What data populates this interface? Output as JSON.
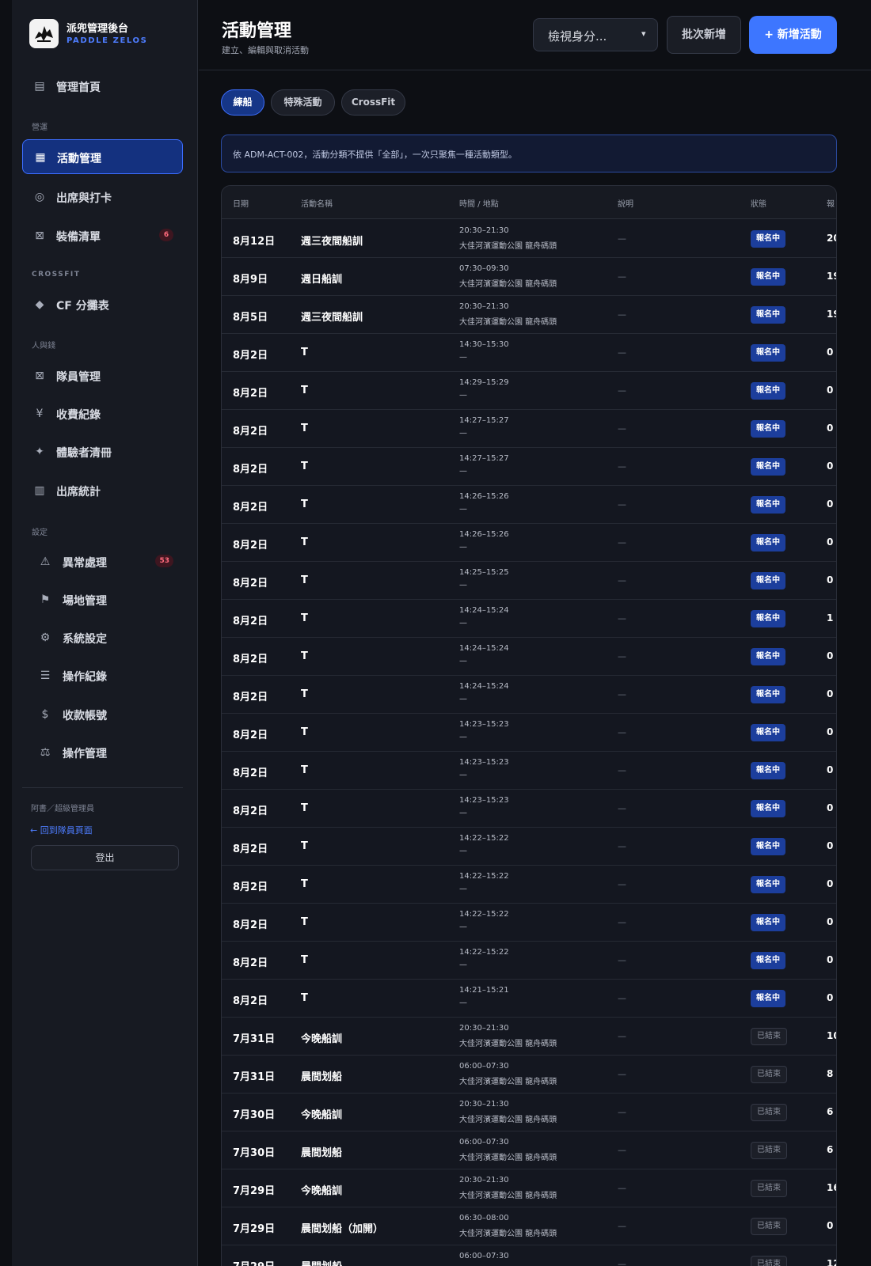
{
  "brand": {
    "title": "派兜管理後台",
    "subtitle": "PADDLE ZELOS"
  },
  "sidebar": {
    "items": [
      {
        "id": "home",
        "label": "管理首頁",
        "icon": "list-icon",
        "glyph": "▤"
      },
      {
        "id": "activities",
        "label": "活動管理",
        "icon": "grid-icon",
        "glyph": "▦"
      },
      {
        "id": "attendance",
        "label": "出席與打卡",
        "icon": "target-icon",
        "glyph": "◎"
      },
      {
        "id": "equipment",
        "label": "裝備清單",
        "icon": "box-icon",
        "glyph": "⊠",
        "badge": "6"
      },
      {
        "id": "cf-groups",
        "label": "CF 分攤表",
        "icon": "diamond-icon",
        "glyph": "◆"
      },
      {
        "id": "members",
        "label": "隊員管理",
        "icon": "user-card-icon",
        "glyph": "⊠"
      },
      {
        "id": "payments",
        "label": "收費紀錄",
        "icon": "yen-icon",
        "glyph": "¥"
      },
      {
        "id": "trials",
        "label": "體驗者清冊",
        "icon": "sparkle-icon",
        "glyph": "✦"
      },
      {
        "id": "stats",
        "label": "出席統計",
        "icon": "columns-icon",
        "glyph": "▥"
      },
      {
        "id": "exceptions",
        "label": "異常處理",
        "icon": "warning-icon",
        "glyph": "⚠",
        "badge": "53"
      },
      {
        "id": "venues",
        "label": "場地管理",
        "icon": "flag-icon",
        "glyph": "⚑"
      },
      {
        "id": "settings",
        "label": "系統設定",
        "icon": "gear-icon",
        "glyph": "⚙"
      },
      {
        "id": "logs",
        "label": "操作紀錄",
        "icon": "menu-icon",
        "glyph": "☰"
      },
      {
        "id": "accounts",
        "label": "收款帳號",
        "icon": "dollar-icon",
        "glyph": "$"
      },
      {
        "id": "operations",
        "label": "操作管理",
        "icon": "scale-icon",
        "glyph": "⚖"
      }
    ],
    "sections": {
      "ops": "營運",
      "crossfit": "CROSSFIT",
      "people": "人與錢",
      "settings": "設定"
    },
    "user": "阿書／超級管理員",
    "back_link": "← 回到隊員頁面",
    "logout": "登出"
  },
  "header": {
    "title": "活動管理",
    "subtitle": "建立、編輯與取消活動",
    "role_select": "檢視身分...",
    "batch_button": "批次新增",
    "new_button": "+ 新增活動"
  },
  "tabs": [
    "練船",
    "特殊活動",
    "CrossFit"
  ],
  "notice": "依 ADM-ACT-002，活動分類不提供「全部」，一次只聚焦一種活動類型。",
  "table": {
    "headers": [
      "日期",
      "活動名稱",
      "時間 / 地點",
      "說明",
      "狀態",
      "報"
    ],
    "rows": [
      {
        "date": "8月12日",
        "name": "週三夜間船訓",
        "time": "20:30–21:30",
        "place": "大佳河濱運動公園 龍舟碼頭",
        "desc": "—",
        "status": "報名中",
        "signup": "20"
      },
      {
        "date": "8月9日",
        "name": "週日船訓",
        "time": "07:30–09:30",
        "place": "大佳河濱運動公園 龍舟碼頭",
        "desc": "—",
        "status": "報名中",
        "signup": "19"
      },
      {
        "date": "8月5日",
        "name": "週三夜間船訓",
        "time": "20:30–21:30",
        "place": "大佳河濱運動公園 龍舟碼頭",
        "desc": "—",
        "status": "報名中",
        "signup": "19"
      },
      {
        "date": "8月2日",
        "name": "T",
        "time": "14:30–15:30",
        "place": "—",
        "desc": "—",
        "status": "報名中",
        "signup": "0 /"
      },
      {
        "date": "8月2日",
        "name": "T",
        "time": "14:29–15:29",
        "place": "—",
        "desc": "—",
        "status": "報名中",
        "signup": "0 /"
      },
      {
        "date": "8月2日",
        "name": "T",
        "time": "14:27–15:27",
        "place": "—",
        "desc": "—",
        "status": "報名中",
        "signup": "0 /"
      },
      {
        "date": "8月2日",
        "name": "T",
        "time": "14:27–15:27",
        "place": "—",
        "desc": "—",
        "status": "報名中",
        "signup": "0 /"
      },
      {
        "date": "8月2日",
        "name": "T",
        "time": "14:26–15:26",
        "place": "—",
        "desc": "—",
        "status": "報名中",
        "signup": "0 /"
      },
      {
        "date": "8月2日",
        "name": "T",
        "time": "14:26–15:26",
        "place": "—",
        "desc": "—",
        "status": "報名中",
        "signup": "0 /"
      },
      {
        "date": "8月2日",
        "name": "T",
        "time": "14:25–15:25",
        "place": "—",
        "desc": "—",
        "status": "報名中",
        "signup": "0 /"
      },
      {
        "date": "8月2日",
        "name": "T",
        "time": "14:24–15:24",
        "place": "—",
        "desc": "—",
        "status": "報名中",
        "signup": "1 /"
      },
      {
        "date": "8月2日",
        "name": "T",
        "time": "14:24–15:24",
        "place": "—",
        "desc": "—",
        "status": "報名中",
        "signup": "0 /"
      },
      {
        "date": "8月2日",
        "name": "T",
        "time": "14:24–15:24",
        "place": "—",
        "desc": "—",
        "status": "報名中",
        "signup": "0 /"
      },
      {
        "date": "8月2日",
        "name": "T",
        "time": "14:23–15:23",
        "place": "—",
        "desc": "—",
        "status": "報名中",
        "signup": "0 /"
      },
      {
        "date": "8月2日",
        "name": "T",
        "time": "14:23–15:23",
        "place": "—",
        "desc": "—",
        "status": "報名中",
        "signup": "0 /"
      },
      {
        "date": "8月2日",
        "name": "T",
        "time": "14:23–15:23",
        "place": "—",
        "desc": "—",
        "status": "報名中",
        "signup": "0 /"
      },
      {
        "date": "8月2日",
        "name": "T",
        "time": "14:22–15:22",
        "place": "—",
        "desc": "—",
        "status": "報名中",
        "signup": "0 /"
      },
      {
        "date": "8月2日",
        "name": "T",
        "time": "14:22–15:22",
        "place": "—",
        "desc": "—",
        "status": "報名中",
        "signup": "0 /"
      },
      {
        "date": "8月2日",
        "name": "T",
        "time": "14:22–15:22",
        "place": "—",
        "desc": "—",
        "status": "報名中",
        "signup": "0 /"
      },
      {
        "date": "8月2日",
        "name": "T",
        "time": "14:22–15:22",
        "place": "—",
        "desc": "—",
        "status": "報名中",
        "signup": "0 /"
      },
      {
        "date": "8月2日",
        "name": "T",
        "time": "14:21–15:21",
        "place": "—",
        "desc": "—",
        "status": "報名中",
        "signup": "0 /"
      },
      {
        "date": "7月31日",
        "name": "今晚船訓",
        "time": "20:30–21:30",
        "place": "大佳河濱運動公園 龍舟碼頭",
        "desc": "—",
        "status": "已結束",
        "signup": "10"
      },
      {
        "date": "7月31日",
        "name": "晨間划船",
        "time": "06:00–07:30",
        "place": "大佳河濱運動公園 龍舟碼頭",
        "desc": "—",
        "status": "已結束",
        "signup": "8"
      },
      {
        "date": "7月30日",
        "name": "今晚船訓",
        "time": "20:30–21:30",
        "place": "大佳河濱運動公園 龍舟碼頭",
        "desc": "—",
        "status": "已結束",
        "signup": "6"
      },
      {
        "date": "7月30日",
        "name": "晨間划船",
        "time": "06:00–07:30",
        "place": "大佳河濱運動公園 龍舟碼頭",
        "desc": "—",
        "status": "已結束",
        "signup": "6"
      },
      {
        "date": "7月29日",
        "name": "今晚船訓",
        "time": "20:30–21:30",
        "place": "大佳河濱運動公園 龍舟碼頭",
        "desc": "—",
        "status": "已結束",
        "signup": "16"
      },
      {
        "date": "7月29日",
        "name": "晨間划船（加開）",
        "time": "06:30–08:00",
        "place": "大佳河濱運動公園 龍舟碼頭",
        "desc": "—",
        "status": "已結束",
        "signup": "0"
      },
      {
        "date": "7月29日",
        "name": "晨間划船",
        "time": "06:00–07:30",
        "place": "大佳河濱運動公園 龍舟碼頭",
        "desc": "—",
        "status": "已結束",
        "signup": "12"
      }
    ]
  },
  "colors": {
    "accent": "#3d76ff",
    "status_open": "#1c3e9c",
    "status_closed": "#1c1f28",
    "badge_text": "#ff6b7d",
    "background": "#0d0f14",
    "sidebar": "#171a22"
  }
}
